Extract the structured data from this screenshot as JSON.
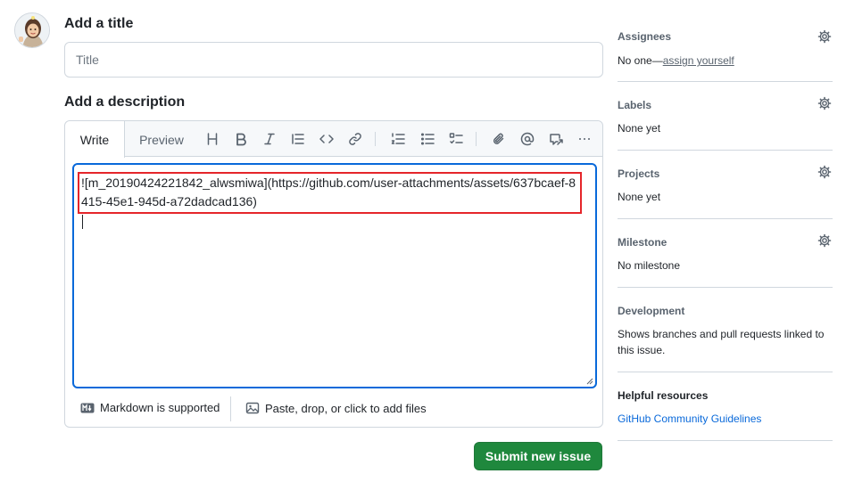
{
  "title_section": {
    "heading": "Add a title",
    "placeholder": "Title"
  },
  "description_section": {
    "heading": "Add a description"
  },
  "editor": {
    "tabs": {
      "write": "Write",
      "preview": "Preview"
    },
    "toolbar_icons": [
      "heading-icon",
      "bold-icon",
      "italic-icon",
      "quote-icon",
      "code-icon",
      "link-icon",
      "numbered-list-icon",
      "unordered-list-icon",
      "task-list-icon",
      "attach-icon",
      "mention-icon",
      "reference-icon",
      "more-icon"
    ],
    "content": "![m_20190424221842_alwsmiwa](https://github.com/user-attachments/assets/637bcaef-8415-45e1-945d-a72dadcad136)",
    "footer": {
      "markdown_label": "Markdown is supported",
      "attach_label": "Paste, drop, or click to add files"
    }
  },
  "submit_label": "Submit new issue",
  "sidebar": {
    "assignees": {
      "heading": "Assignees",
      "prefix": "No one—",
      "link": "assign yourself"
    },
    "labels": {
      "heading": "Labels",
      "value": "None yet"
    },
    "projects": {
      "heading": "Projects",
      "value": "None yet"
    },
    "milestone": {
      "heading": "Milestone",
      "value": "No milestone"
    },
    "development": {
      "heading": "Development",
      "description": "Shows branches and pull requests linked to this issue."
    },
    "helpful": {
      "heading": "Helpful resources",
      "link": "GitHub Community Guidelines"
    }
  },
  "colors": {
    "accent": "#0969da",
    "submit": "#1f883d",
    "highlight": "#e5252a"
  }
}
